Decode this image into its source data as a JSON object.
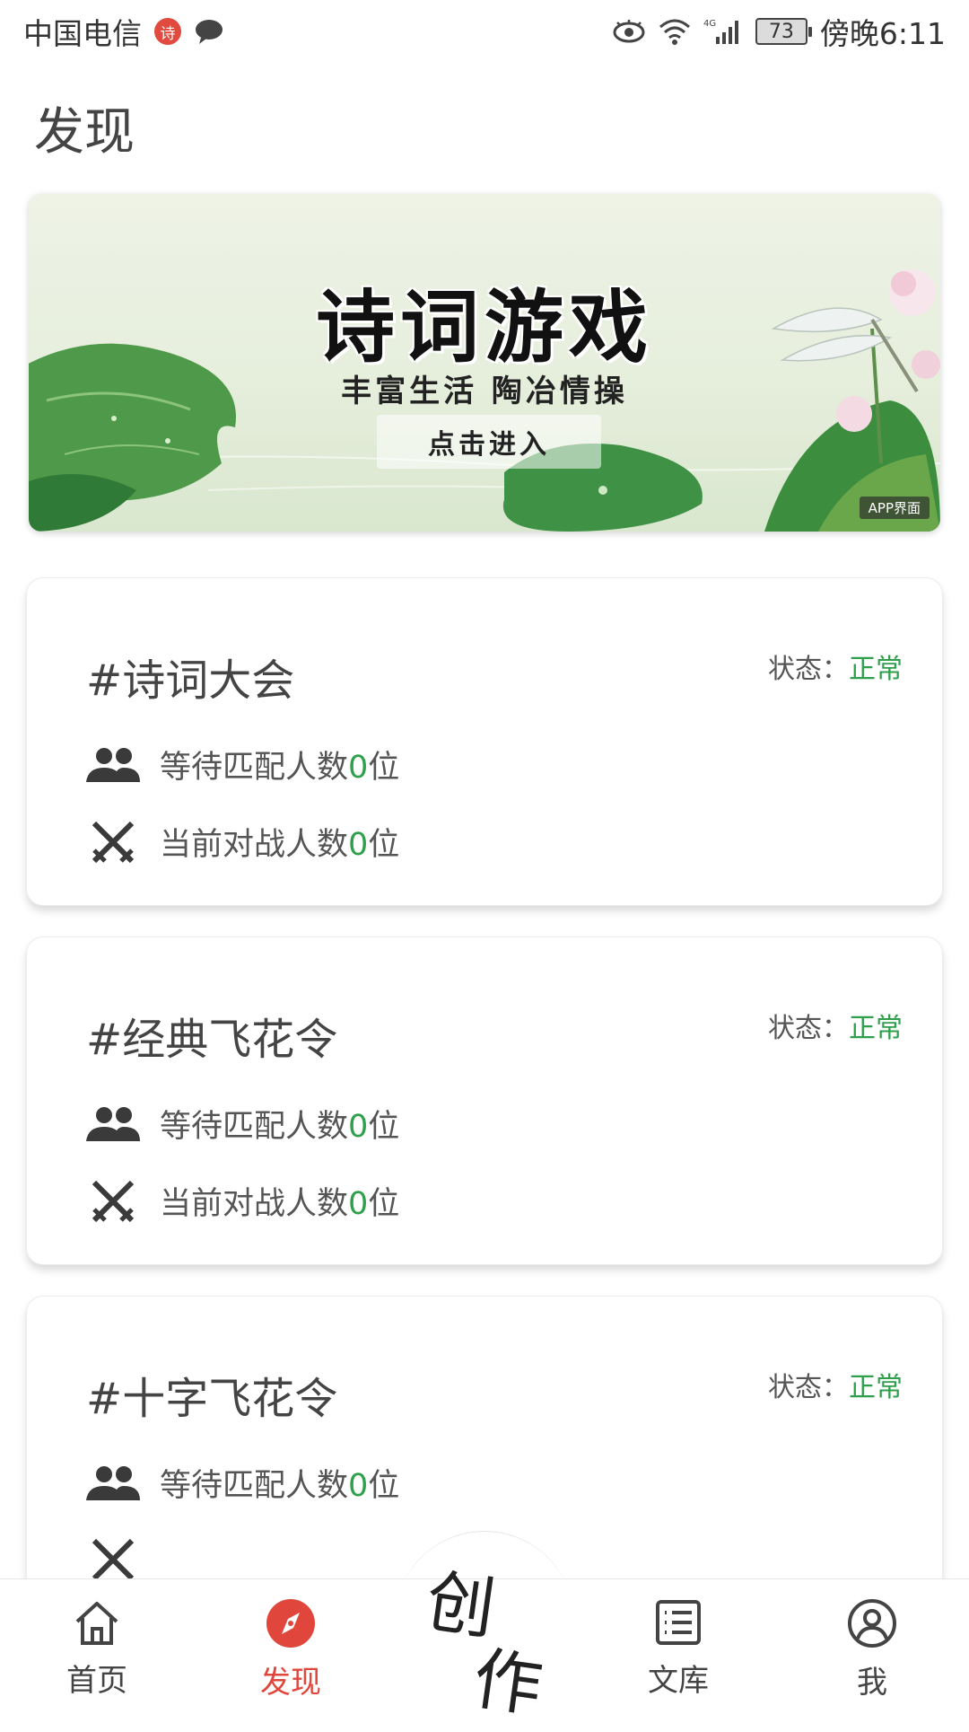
{
  "status_bar": {
    "carrier": "中国电信",
    "battery": "73",
    "time": "傍晚6:11"
  },
  "page": {
    "title": "发现"
  },
  "banner": {
    "title": "诗词游戏",
    "subtitle": "丰富生活 陶冶情操",
    "button": "点击进入",
    "tag": "APP界面"
  },
  "cards": [
    {
      "title": "#诗词大会",
      "status_label": "状态：",
      "status_value": "正常",
      "waiting_prefix": "等待匹配人数",
      "waiting_count": "0",
      "waiting_suffix": "位",
      "battle_prefix": "当前对战人数",
      "battle_count": "0",
      "battle_suffix": "位"
    },
    {
      "title": "#经典飞花令",
      "status_label": "状态：",
      "status_value": "正常",
      "waiting_prefix": "等待匹配人数",
      "waiting_count": "0",
      "waiting_suffix": "位",
      "battle_prefix": "当前对战人数",
      "battle_count": "0",
      "battle_suffix": "位"
    },
    {
      "title": "#十字飞花令",
      "status_label": "状态：",
      "status_value": "正常",
      "waiting_prefix": "等待匹配人数",
      "waiting_count": "0",
      "waiting_suffix": "位"
    }
  ],
  "nav": {
    "home": "首页",
    "discover": "发现",
    "create_1": "创",
    "create_2": "作",
    "library": "文库",
    "me": "我"
  },
  "colors": {
    "accent_green": "#2e9f4a",
    "active_red": "#e0463b"
  }
}
